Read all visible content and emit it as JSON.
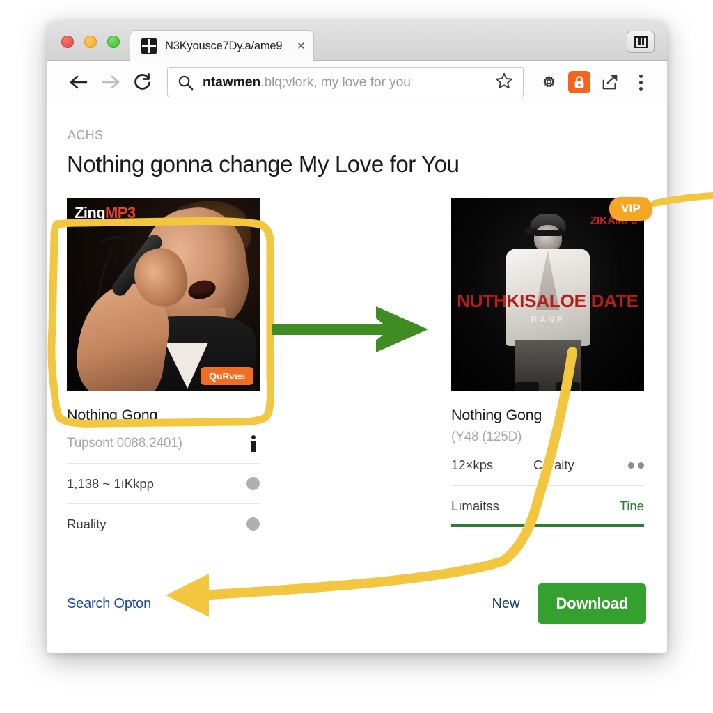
{
  "browser": {
    "tab": {
      "title": "N3Kyousce7Dy.a/ame9",
      "close_label": "×",
      "favicon": "grid-favicon"
    },
    "window_button": "panel-layout-icon",
    "nav": {
      "back": "back-arrow-icon",
      "forward": "forward-arrow-icon",
      "reload": "reload-icon"
    },
    "omnibox": {
      "search_icon": "search-icon",
      "value_bold": "ntawmen",
      "value_rest": ".blq;vlork, my love for you",
      "star_icon": "bookmark-star-icon"
    },
    "toolbar_icons": {
      "gear": "gear-icon",
      "lock": "lock-icon",
      "share": "share-icon",
      "menu": "kebab-menu-icon"
    }
  },
  "page": {
    "eyebrow": "ACHS",
    "headline": "Nothing gonna change My Love for You",
    "vip_badge": "VIP"
  },
  "left_card": {
    "art": {
      "watermark_part1": "Zing",
      "watermark_part2": "MP3",
      "badge": "QuRves"
    },
    "title": "Nothing Gong",
    "subtitle": "Tupsont 0088.2401)",
    "info_icon": "info-icon",
    "rows": [
      {
        "label": "1,138 ~ 1ıKkpp",
        "control": "radio-dot"
      },
      {
        "label": "Ruality",
        "control": "radio-dot"
      }
    ]
  },
  "right_card": {
    "art": {
      "watermark": "ZIKAMP3",
      "title": "NUTHKISALOE DATE",
      "subtitle": "RANE"
    },
    "title": "Nothing Gong",
    "subtitle": "(Y48 (125D)",
    "row_bitrate": "12×kps",
    "row_quality": "Caraity",
    "row_dots": "two-dots-indicator",
    "row_limits": "Lımaitss",
    "row_value": "Tine"
  },
  "footer": {
    "search_option": "Search Opton",
    "new": "New",
    "download": "Download"
  },
  "colors": {
    "accent_green": "#34a02e",
    "arrow_green": "#3e8c22",
    "arrow_yellow": "#f5c33c",
    "vip_orange": "#f5a623",
    "link_blue": "#1a4a9c",
    "lock_orange": "#f4641d"
  }
}
